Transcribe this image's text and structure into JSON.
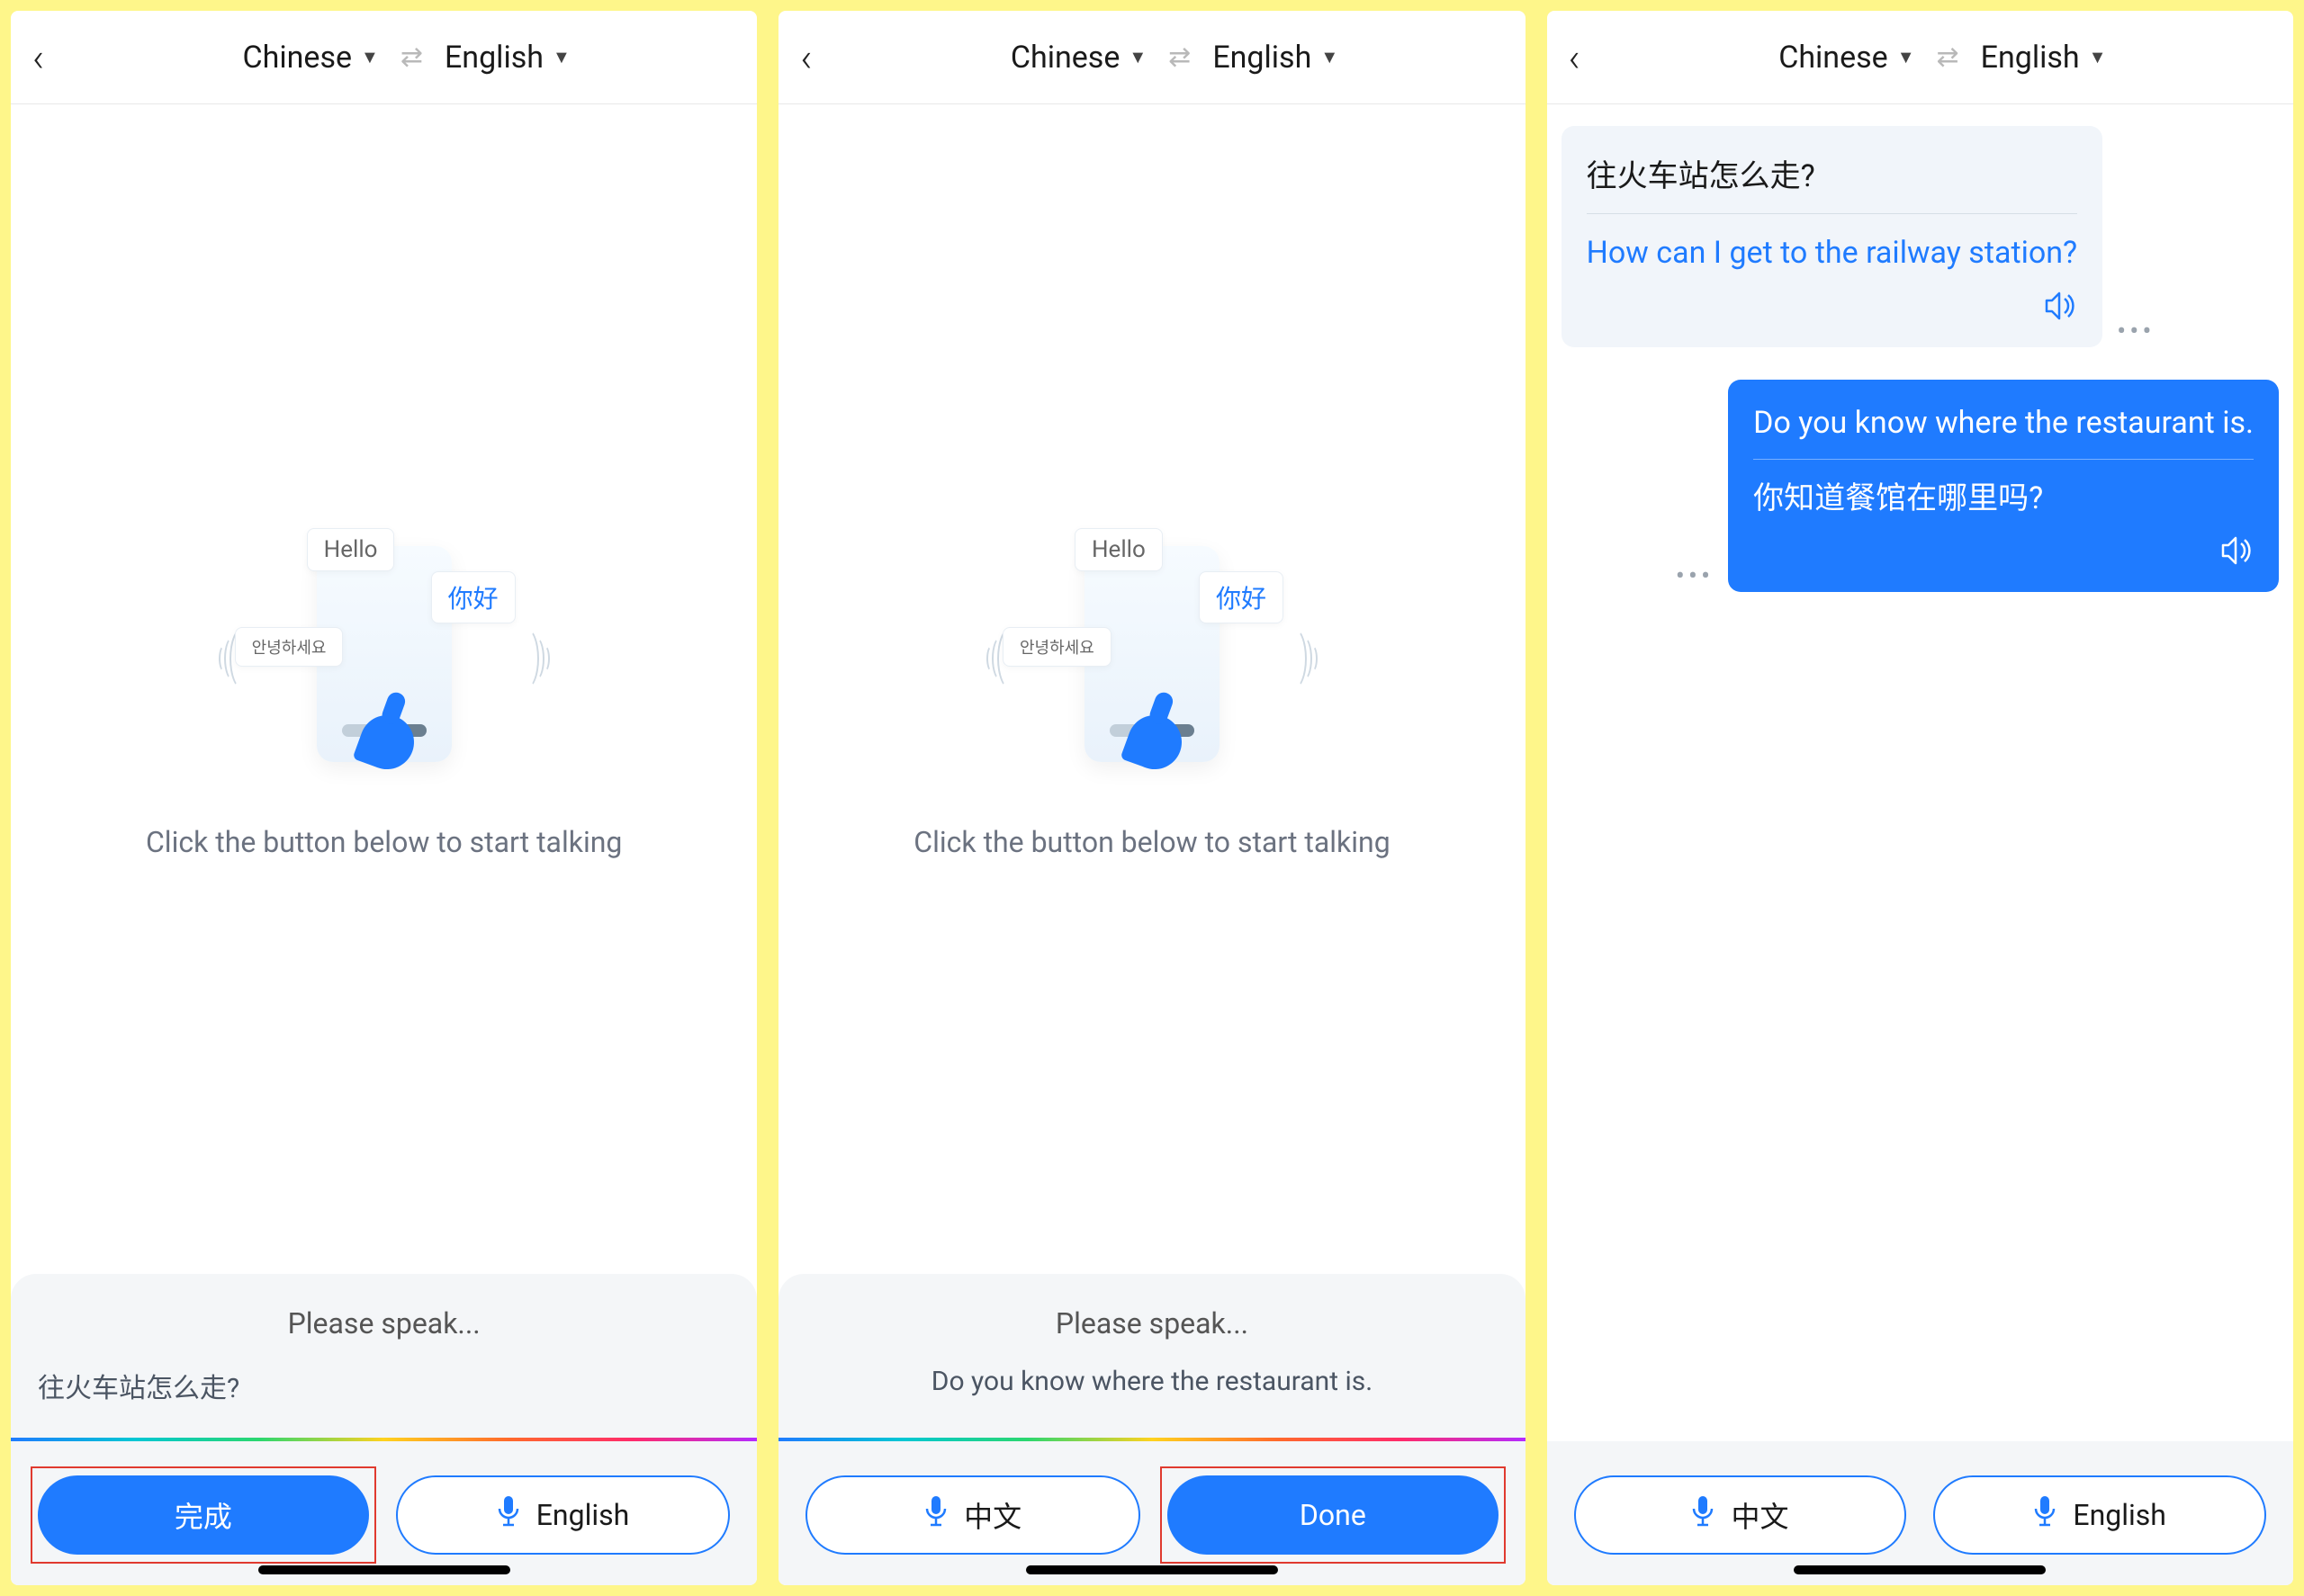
{
  "header": {
    "lang_from": "Chinese",
    "lang_to": "English"
  },
  "illustration": {
    "bubble_hello": "Hello",
    "bubble_nihao": "你好",
    "bubble_korean": "안녕하세요"
  },
  "prompt": "Click the button below to start talking",
  "speak_title": "Please speak...",
  "panel1": {
    "speak_text": "往火车站怎么走?",
    "primary_btn": "完成",
    "secondary_btn": "English"
  },
  "panel2": {
    "speak_text": "Do you know where the restaurant is.",
    "secondary_btn": "中文",
    "primary_btn": "Done"
  },
  "panel3": {
    "msg1": {
      "src": "往火车站怎么走?",
      "trans": "How can I get to the railway station?"
    },
    "msg2": {
      "src": "Do you know where the restaurant is.",
      "trans": "你知道餐馆在哪里吗?"
    },
    "btn_left": "中文",
    "btn_right": "English"
  }
}
